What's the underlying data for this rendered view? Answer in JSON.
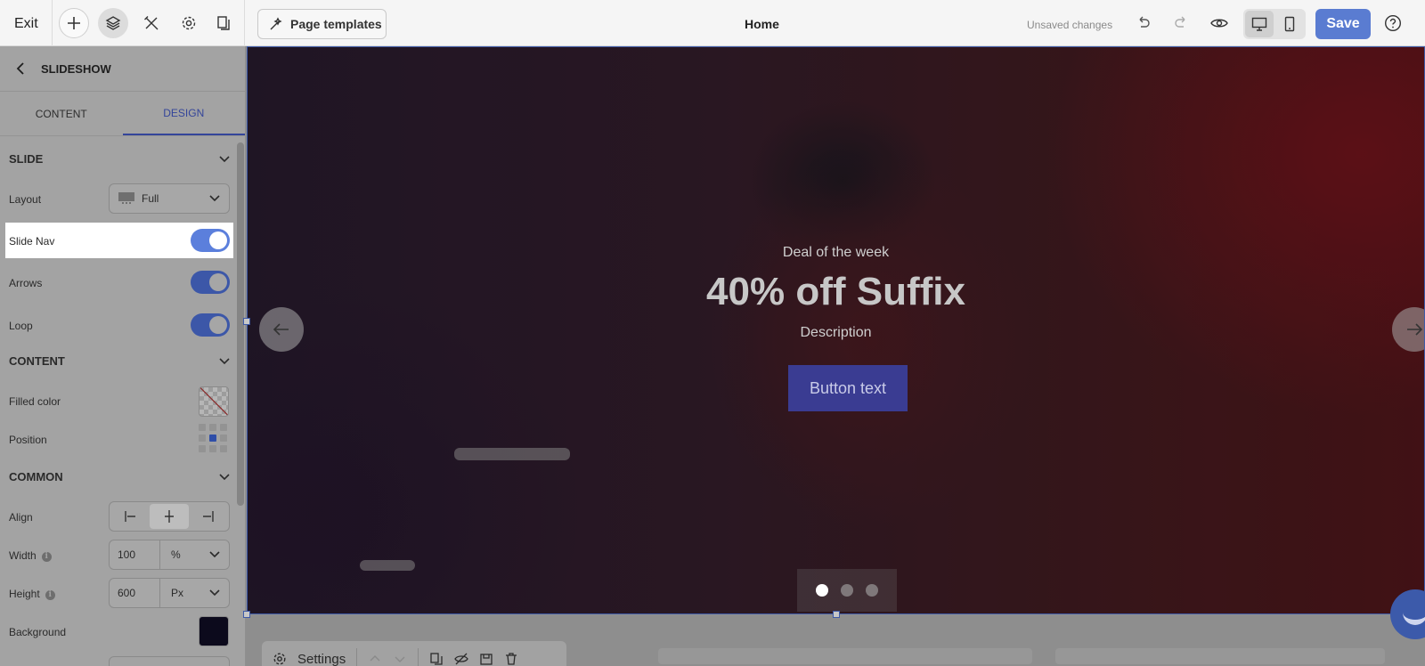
{
  "topbar": {
    "exit_label": "Exit",
    "templates_label": "Page templates",
    "page_title": "Home",
    "unsaved_label": "Unsaved changes",
    "save_label": "Save",
    "icons": [
      "plus-icon",
      "layers-icon",
      "tools-icon",
      "gear-icon",
      "pages-icon",
      "undo-icon",
      "redo-icon",
      "eye-icon",
      "desktop-icon",
      "mobile-icon",
      "help-icon"
    ]
  },
  "sidebar": {
    "title": "SLIDESHOW",
    "tabs": [
      {
        "label": "CONTENT",
        "active": false
      },
      {
        "label": "DESIGN",
        "active": true
      }
    ],
    "sections": {
      "slide": "SLIDE",
      "content": "CONTENT",
      "common": "COMMON"
    },
    "layout_label": "Layout",
    "layout_value": "Full",
    "slide_nav_label": "Slide Nav",
    "slide_nav_on": true,
    "arrows_label": "Arrows",
    "arrows_on": true,
    "loop_label": "Loop",
    "loop_on": true,
    "filled_color_label": "Filled color",
    "position_label": "Position",
    "align_label": "Align",
    "width_label": "Width",
    "width_value": "100",
    "width_unit": "%",
    "height_label": "Height",
    "height_value": "600",
    "height_unit": "Px",
    "background_label": "Background",
    "background_color": "#0c0a1c"
  },
  "slide": {
    "subtitle": "Deal of the week",
    "title": "40% off Suffix",
    "description": "Description",
    "button_label": "Button text",
    "dot_count": 3,
    "active_dot": 0
  },
  "float_toolbar": {
    "settings_label": "Settings"
  },
  "colors": {
    "accent": "#5a7cd1",
    "slide_button": "#3a3c92",
    "selection": "#3f5ba8"
  }
}
